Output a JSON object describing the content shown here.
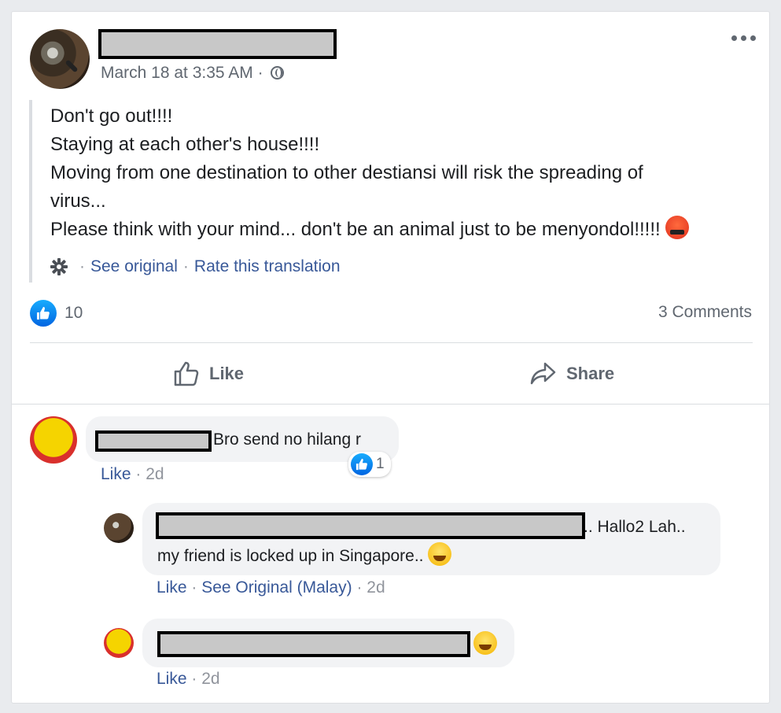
{
  "post": {
    "timestamp": "March 18 at 3:35 AM",
    "timestamp_sep": "·",
    "audience_icon": "globe-icon",
    "lines": [
      "Don't go out!!!!",
      "Staying at each other's house!!!!",
      "Moving from one destination to other destiansi will risk the spreading of",
      "virus...",
      "Please think with your mind... don't be an animal just to be menyondol!!!!!"
    ],
    "see_original": "See original",
    "rate_translation": "Rate this translation",
    "sep": "·",
    "like_count": "10",
    "comments_count": "3 Comments",
    "like_label": "Like",
    "share_label": "Share"
  },
  "comments": [
    {
      "text": "Bro send no hilang r",
      "reaction_count": "1",
      "like": "Like",
      "time": "2d"
    },
    {
      "text_line1": ".. Hallo2 Lah..",
      "text_line2": "my friend is locked up in Singapore..",
      "like": "Like",
      "see_original": "See Original (Malay)",
      "time": "2d"
    },
    {
      "like": "Like",
      "time": "2d"
    }
  ],
  "colors": {
    "link": "#385898",
    "meta": "#606770",
    "like_blue": "#1877f2"
  }
}
